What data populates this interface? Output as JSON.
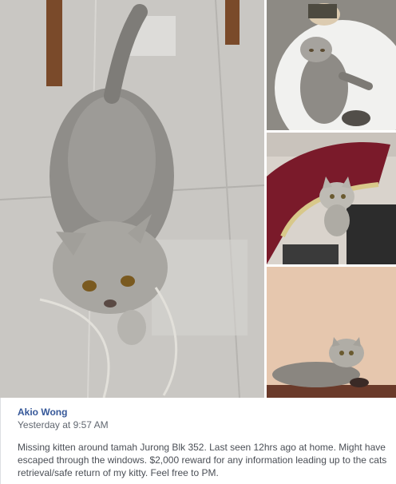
{
  "post": {
    "author": "Akio Wong",
    "timestamp": "Yesterday at 9:57 AM",
    "message": "Missing kitten around tamah Jurong Blk 352. Last seen 12hrs ago at home. Might have escaped through the windows. $2,000 reward for any information leading up to the cats retrieval/safe return of my kitty. Feel free to PM."
  },
  "colors": {
    "author_link": "#365899",
    "timestamp": "#616770",
    "message": "#4b4f56"
  }
}
